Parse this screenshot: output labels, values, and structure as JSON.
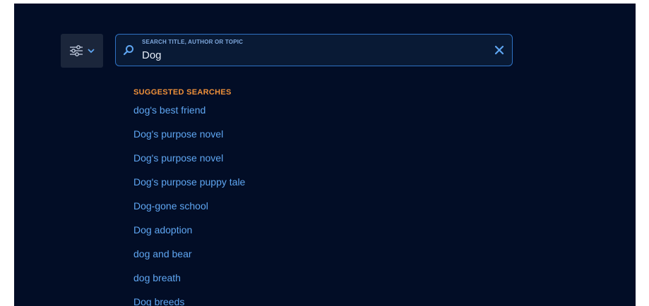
{
  "colors": {
    "background": "#020d26",
    "accent": "#2f72c4",
    "heading": "#f0913a",
    "link": "#5fa6f2"
  },
  "filter": {
    "icon": "sliders-icon",
    "dropdown_icon": "chevron-down-icon"
  },
  "search": {
    "label": "SEARCH TITLE, AUTHOR OR TOPIC",
    "value": "Dog",
    "icon": "search-icon",
    "clear_icon": "close-icon"
  },
  "suggestions": {
    "heading": "SUGGESTED SEARCHES",
    "items": [
      "dog's best friend",
      "Dog's purpose novel",
      "Dog's purpose novel",
      "Dog's purpose puppy tale",
      "Dog-gone school",
      "Dog adoption",
      "dog and bear",
      "dog breath",
      "Dog breeds"
    ]
  }
}
